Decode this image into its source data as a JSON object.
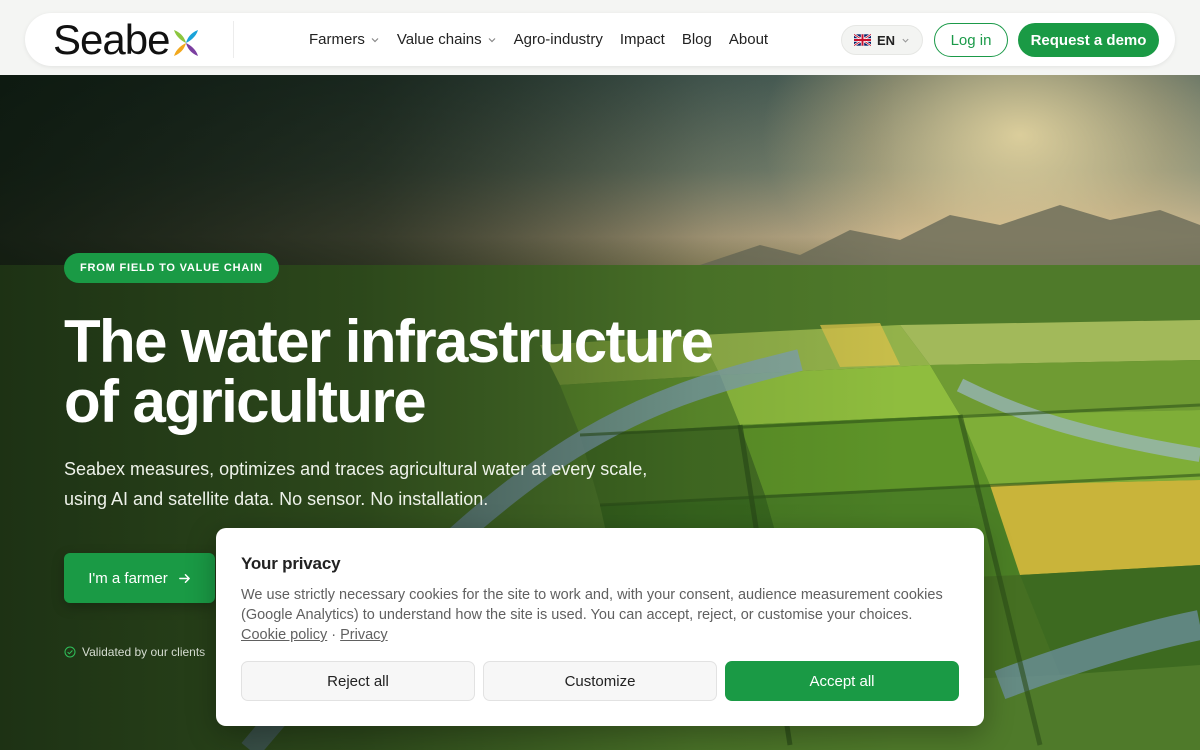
{
  "brand": {
    "logo_text": "Seabe",
    "logo_mark": "x-icon",
    "accent": "#1a9a45"
  },
  "nav": {
    "items": [
      {
        "label": "Farmers",
        "has_dropdown": true
      },
      {
        "label": "Value chains",
        "has_dropdown": true
      },
      {
        "label": "Agro-industry",
        "has_dropdown": false
      },
      {
        "label": "Impact",
        "has_dropdown": false
      },
      {
        "label": "Blog",
        "has_dropdown": false
      },
      {
        "label": "About",
        "has_dropdown": false
      }
    ],
    "language": "EN",
    "language_flag": "uk-flag-icon",
    "login_label": "Log in",
    "demo_label": "Request a demo"
  },
  "hero": {
    "badge": "FROM FIELD TO VALUE CHAIN",
    "title_line1": "The water infrastructure",
    "title_line2": "of agriculture",
    "subtitle_line1": "Seabex measures, optimizes and traces agricultural water at every scale,",
    "subtitle_line2": "using AI and satellite data. No sensor. No installation.",
    "cta_label": "I'm a farmer",
    "validated_text": "Validated by our clients"
  },
  "cookie": {
    "title": "Your privacy",
    "text": "We use strictly necessary cookies for the site to work and, with your consent, audience measurement cookies (Google Analytics) to understand how the site is used. You can accept, reject, or customise your choices.",
    "link_policy": "Cookie policy",
    "link_separator": " · ",
    "link_privacy": "Privacy",
    "reject_label": "Reject all",
    "customize_label": "Customize",
    "accept_label": "Accept all"
  }
}
